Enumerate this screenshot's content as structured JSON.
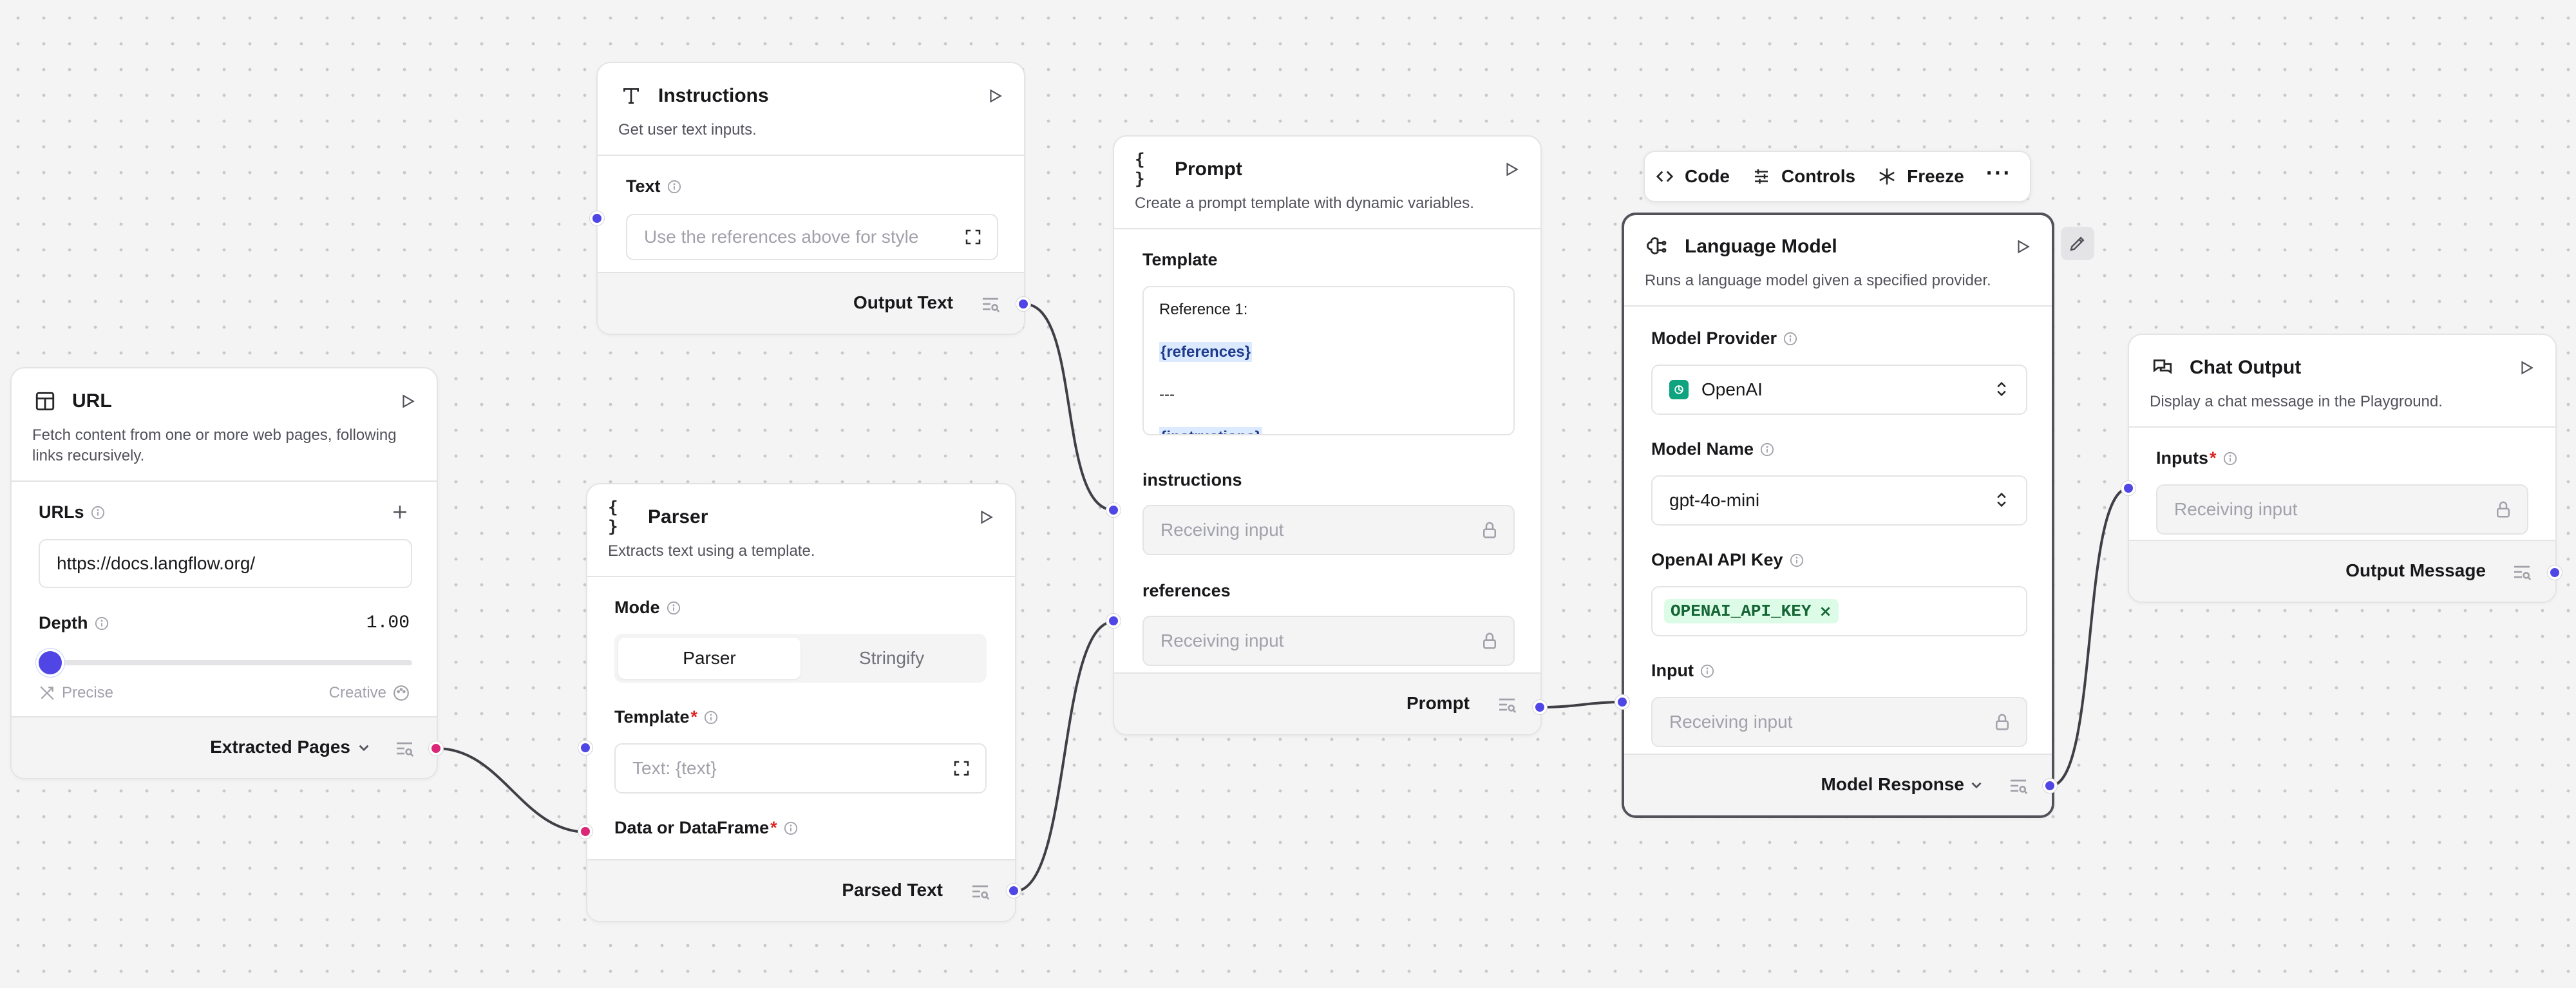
{
  "nodes": {
    "url": {
      "title": "URL",
      "description": "Fetch content from one or more web pages, following links recursively.",
      "urls_label": "URLs",
      "url_value": "https://docs.langflow.org/",
      "depth_label": "Depth",
      "depth_value": "1.00",
      "slider_min_label": "Precise",
      "slider_max_label": "Creative",
      "slider_fraction": 0,
      "output_label": "Extracted Pages"
    },
    "instructions": {
      "title": "Instructions",
      "description": "Get user text inputs.",
      "text_label": "Text",
      "text_placeholder": "Use the references above for style",
      "output_label": "Output Text"
    },
    "parser": {
      "title": "Parser",
      "description": "Extracts text using a template.",
      "mode_label": "Mode",
      "mode_options": [
        "Parser",
        "Stringify"
      ],
      "mode_selected": "Parser",
      "template_label": "Template",
      "template_placeholder": "Text: {text}",
      "data_label": "Data or DataFrame",
      "output_label": "Parsed Text"
    },
    "prompt": {
      "title": "Prompt",
      "description": "Create a prompt template with dynamic variables.",
      "template_label": "Template",
      "template_lines": [
        "Reference 1:",
        "{references}",
        "---",
        "{instructions}"
      ],
      "instructions_label": "instructions",
      "references_label": "references",
      "receiving": "Receiving input",
      "output_label": "Prompt"
    },
    "language_model": {
      "title": "Language Model",
      "description": "Runs a language model given a specified provider.",
      "provider_label": "Model Provider",
      "provider_value": "OpenAI",
      "model_label": "Model Name",
      "model_value": "gpt-4o-mini",
      "api_key_label": "OpenAI API Key",
      "api_key_value": "OPENAI_API_KEY",
      "input_label": "Input",
      "receiving": "Receiving input",
      "output_label": "Model Response"
    },
    "chat_output": {
      "title": "Chat Output",
      "description": "Display a chat message in the Playground.",
      "inputs_label": "Inputs",
      "receiving": "Receiving input",
      "output_label": "Output Message"
    }
  },
  "toolbar": {
    "code_label": "Code",
    "controls_label": "Controls",
    "freeze_label": "Freeze"
  },
  "colors": {
    "handle_blue": "#4f46e5",
    "handle_pink": "#db2777",
    "openai_green": "#10a37f"
  }
}
